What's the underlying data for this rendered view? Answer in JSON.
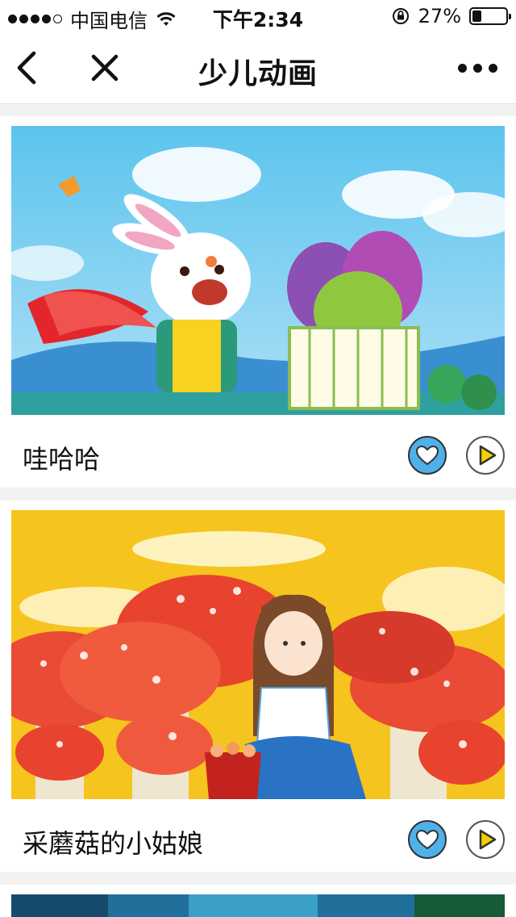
{
  "status_bar": {
    "carrier": "中国电信",
    "time": "下午2:34",
    "battery_percent": "27%",
    "battery_level": 0.27
  },
  "nav": {
    "title": "少儿动画"
  },
  "items": [
    {
      "title": "哇哈哈"
    },
    {
      "title": "采蘑菇的小姑娘"
    }
  ],
  "icons": {
    "back": "chevron-left-icon",
    "close": "close-icon",
    "more": "more-icon",
    "like": "heart-icon",
    "play": "play-icon"
  },
  "colors": {
    "like_button": "#4fb0ea",
    "play_triangle": "#f2d100",
    "page_background": "#f2f2f2"
  }
}
